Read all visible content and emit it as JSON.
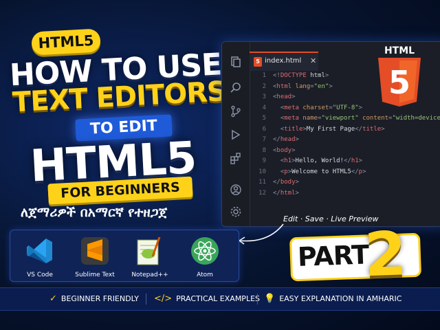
{
  "headline": {
    "badge": "HTML5",
    "line1": "HOW TO USE",
    "line2": "TEXT EDITORS",
    "to_edit": "TO EDIT",
    "line3": "HTML5",
    "for_beginners": "FOR BEGINNERS",
    "amharic": "ለጀማሪዎች በአማርኛ የተዘጋጀ"
  },
  "editor": {
    "tab_label": "index.html",
    "tab_icon": "5",
    "lines": [
      {
        "n": "1",
        "html": "<span class=\"punct\">&lt;!</span><span class=\"tag\">DOCTYPE</span><span class=\"txt\"> html</span><span class=\"punct\">&gt;</span>"
      },
      {
        "n": "2",
        "html": "<span class=\"punct\">&lt;</span><span class=\"tag\">html</span> <span class=\"attr\">lang</span><span class=\"punct\">=</span><span class=\"str\">\"en\"</span><span class=\"punct\">&gt;</span>"
      },
      {
        "n": "3",
        "html": "<span class=\"punct\">&lt;</span><span class=\"tag\">head</span><span class=\"punct\">&gt;</span>"
      },
      {
        "n": "4",
        "html": "  <span class=\"punct\">&lt;</span><span class=\"tag\">meta</span> <span class=\"attr\">charset</span><span class=\"punct\">=</span><span class=\"str\">\"UTF-8\"</span><span class=\"punct\">&gt;</span>"
      },
      {
        "n": "5",
        "html": "  <span class=\"punct\">&lt;</span><span class=\"tag\">meta</span> <span class=\"attr\">name</span><span class=\"punct\">=</span><span class=\"str\">\"viewport\"</span> <span class=\"attr\">content</span><span class=\"punct\">=</span><span class=\"str\">\"width=device-width,</span>"
      },
      {
        "n": "6",
        "html": "  <span class=\"punct\">&lt;</span><span class=\"tag\">title</span><span class=\"punct\">&gt;</span><span class=\"txt\">My First Page</span><span class=\"punct\">&lt;/</span><span class=\"tag\">title</span><span class=\"punct\">&gt;</span>"
      },
      {
        "n": "7",
        "html": "<span class=\"punct\">&lt;/</span><span class=\"tag\">head</span><span class=\"punct\">&gt;</span>"
      },
      {
        "n": "8",
        "html": "<span class=\"punct\">&lt;</span><span class=\"tag\">body</span><span class=\"punct\">&gt;</span>"
      },
      {
        "n": "9",
        "html": "  <span class=\"punct\">&lt;</span><span class=\"tag\">h1</span><span class=\"punct\">&gt;</span><span class=\"txt\">Hello, World!</span><span class=\"punct\">&lt;/</span><span class=\"tag\">h1</span><span class=\"punct\">&gt;</span>"
      },
      {
        "n": "10",
        "html": "  <span class=\"punct\">&lt;</span><span class=\"tag\">p</span><span class=\"punct\">&gt;</span><span class=\"txt\">Welcome to HTML5</span><span class=\"punct\">&lt;/</span><span class=\"tag\">p</span><span class=\"punct\">&gt;</span>"
      },
      {
        "n": "11",
        "html": "<span class=\"punct\">&lt;/</span><span class=\"tag\">body</span><span class=\"punct\">&gt;</span>"
      },
      {
        "n": "12",
        "html": "<span class=\"punct\">&lt;/</span><span class=\"tag\">html</span><span class=\"punct\">&gt;</span>"
      }
    ]
  },
  "logo": {
    "top_text": "HTML",
    "numeral": "5"
  },
  "annotation": "Edit · Save · Live Preview",
  "tools": [
    {
      "name": "vscode",
      "label": "VS Code"
    },
    {
      "name": "sublime",
      "label": "Sublime Text"
    },
    {
      "name": "notepadpp",
      "label": "Notepad++"
    },
    {
      "name": "atom",
      "label": "Atom"
    }
  ],
  "part": {
    "label": "PART",
    "number": "2"
  },
  "features": [
    {
      "icon": "check-icon",
      "glyph": "✓",
      "label": "BEGINNER FRIENDLY"
    },
    {
      "icon": "code-icon",
      "glyph": "</>",
      "label": "PRACTICAL EXAMPLES"
    },
    {
      "icon": "lightbulb-icon",
      "glyph": "💡",
      "label": "EASY EXPLANATION IN AMHARIC"
    }
  ],
  "colors": {
    "accent_yellow": "#ffd21a",
    "html_orange": "#e44d26",
    "bg_navy": "#07142f"
  }
}
